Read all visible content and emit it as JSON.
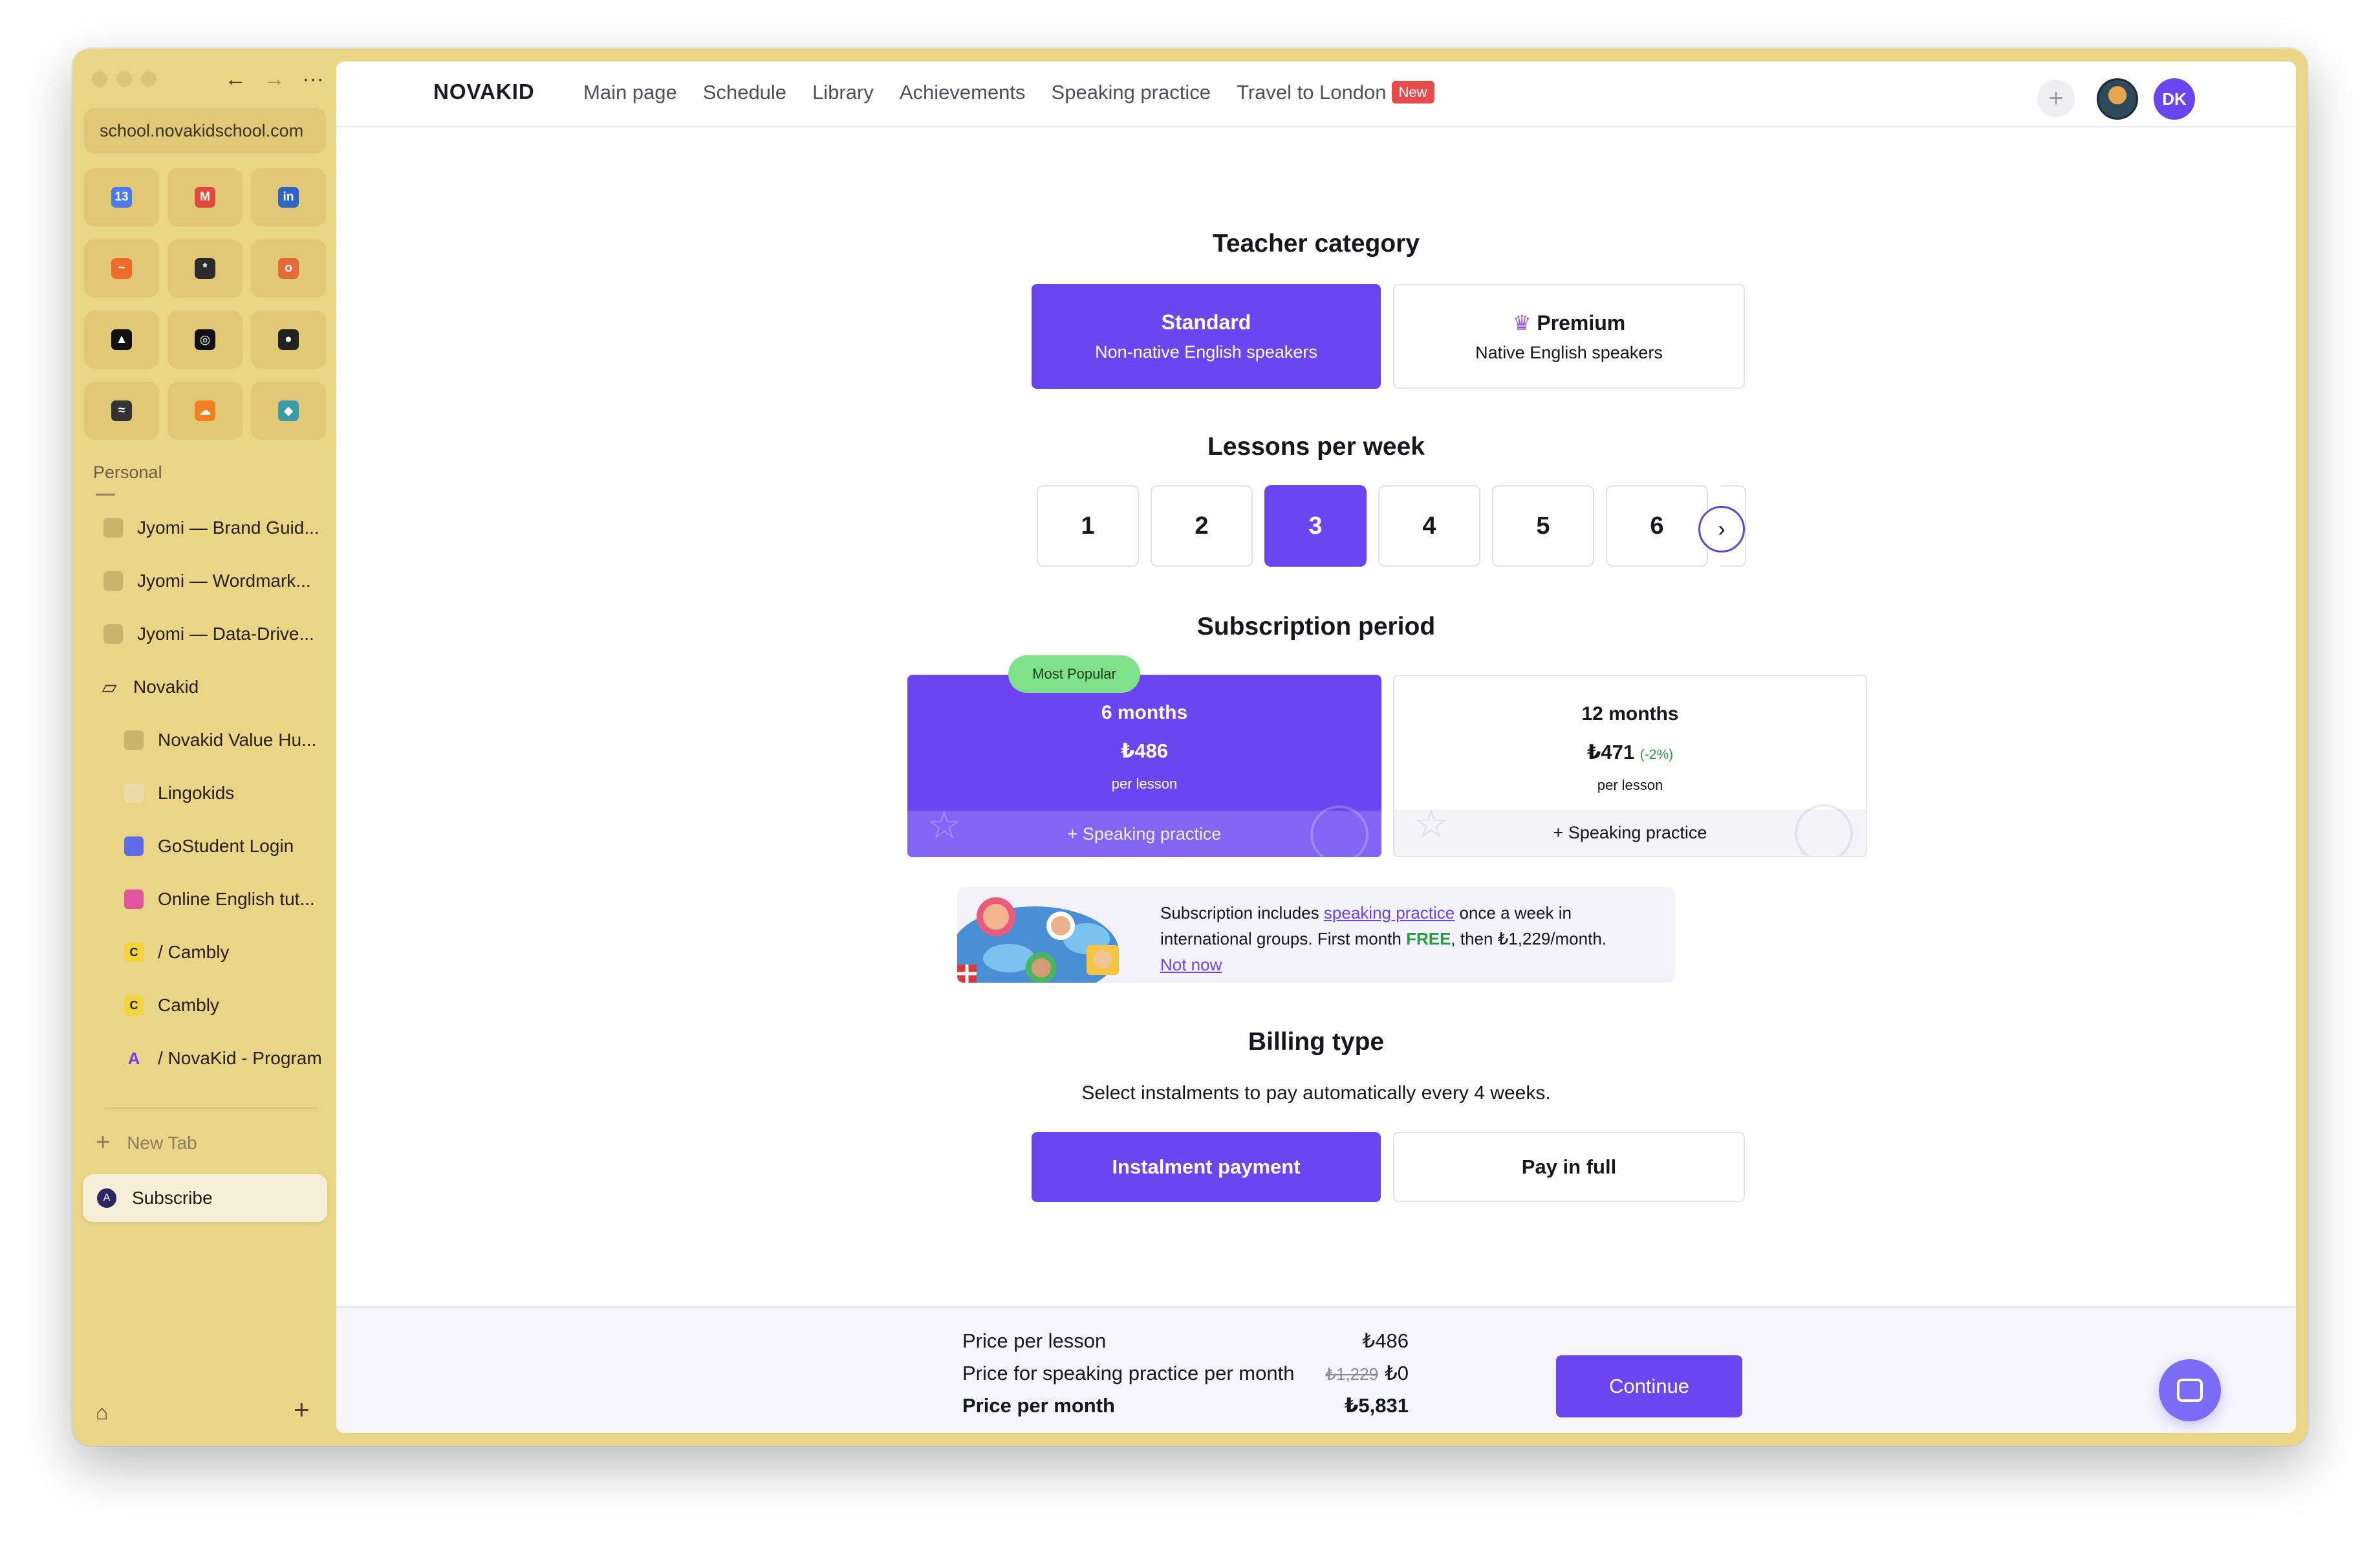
{
  "browser": {
    "url": "school.novakidschool.com",
    "section_label": "Personal",
    "favorites": [
      {
        "icon": "google-calendar-icon",
        "glyph": "13",
        "color": "#4b7be8"
      },
      {
        "icon": "gmail-icon",
        "glyph": "M",
        "color": "#e24b3b"
      },
      {
        "icon": "linkedin-icon",
        "glyph": "in",
        "color": "#2a66c2"
      },
      {
        "icon": "analytics-icon",
        "glyph": "~",
        "color": "#f06a2a"
      },
      {
        "icon": "spark-icon",
        "glyph": "*",
        "color": "#2a2a2a"
      },
      {
        "icon": "bird-icon",
        "glyph": "o",
        "color": "#e36a3a"
      },
      {
        "icon": "vercel-icon",
        "glyph": "▲",
        "color": "#111111"
      },
      {
        "icon": "chatgpt-icon",
        "glyph": "◎",
        "color": "#111111"
      },
      {
        "icon": "github-icon",
        "glyph": "●",
        "color": "#222222"
      },
      {
        "icon": "squarespace-icon",
        "glyph": "≈",
        "color": "#333333"
      },
      {
        "icon": "cloudflare-icon",
        "glyph": "☁",
        "color": "#f38020"
      },
      {
        "icon": "diamond-icon",
        "glyph": "◆",
        "color": "#3a9aa8"
      }
    ],
    "tabs": [
      {
        "label": "Jyomi — Brand Guid...",
        "icon": "doc-icon",
        "level": "l1"
      },
      {
        "label": "Jyomi — Wordmark...",
        "icon": "doc-icon",
        "level": "l1"
      },
      {
        "label": "Jyomi — Data-Drive...",
        "icon": "doc-icon",
        "level": "l1"
      },
      {
        "label": "Novakid",
        "icon": "folder-icon",
        "level": "folder"
      },
      {
        "label": "Novakid Value Hu...",
        "icon": "doc-icon",
        "level": "l2"
      },
      {
        "label": "Lingokids",
        "icon": "lingokids-icon",
        "level": "l2"
      },
      {
        "label": "GoStudent Login",
        "icon": "gostudent-icon",
        "level": "l2"
      },
      {
        "label": "Online English tut...",
        "icon": "preply-icon",
        "level": "l2"
      },
      {
        "label": "/ Cambly",
        "icon": "cambly-icon",
        "level": "l2"
      },
      {
        "label": "Cambly",
        "icon": "cambly-icon",
        "level": "l2"
      },
      {
        "label": "/ NovaKid - Program",
        "icon": "novakid-icon",
        "level": "l2"
      }
    ],
    "new_tab_label": "New Tab",
    "active_tab_label": "Subscribe"
  },
  "header": {
    "logo": "NOVAKID",
    "menu": [
      "Main page",
      "Schedule",
      "Library",
      "Achievements",
      "Speaking practice",
      "Travel to London"
    ],
    "new_badge": "New",
    "user_initials": "DK"
  },
  "teacher": {
    "title": "Teacher category",
    "standard_title": "Standard",
    "standard_sub": "Non-native English speakers",
    "premium_title": "Premium",
    "premium_sub": "Native English speakers"
  },
  "lessons": {
    "title": "Lessons per week",
    "options": [
      "1",
      "2",
      "3",
      "4",
      "5",
      "6"
    ],
    "selected": "3"
  },
  "subscription": {
    "title": "Subscription period",
    "popular_badge": "Most Popular",
    "six": {
      "months": "6 months",
      "price": "₺486",
      "per": "per lesson",
      "extra": "+ Speaking practice"
    },
    "twelve": {
      "months": "12 months",
      "price": "₺471",
      "discount": "(-2%)",
      "per": "per lesson",
      "extra": "+ Speaking practice"
    }
  },
  "promo": {
    "text_a": "Subscription includes ",
    "link": "speaking practice",
    "text_b": " once a week in",
    "text_c": "international groups. First month ",
    "free": "FREE",
    "text_d": ", then ₺1,229/month.",
    "not_now": "Not now"
  },
  "billing": {
    "title": "Billing type",
    "subtitle": "Select instalments to pay automatically every 4 weeks.",
    "instalment": "Instalment payment",
    "full": "Pay in full"
  },
  "footer": {
    "lesson_label": "Price per lesson",
    "lesson_value": "₺486",
    "speaking_label": "Price for speaking practice per month",
    "speaking_old": "₺1,229",
    "speaking_value": "₺0",
    "month_label": "Price per month",
    "month_value": "₺5,831",
    "continue": "Continue"
  }
}
